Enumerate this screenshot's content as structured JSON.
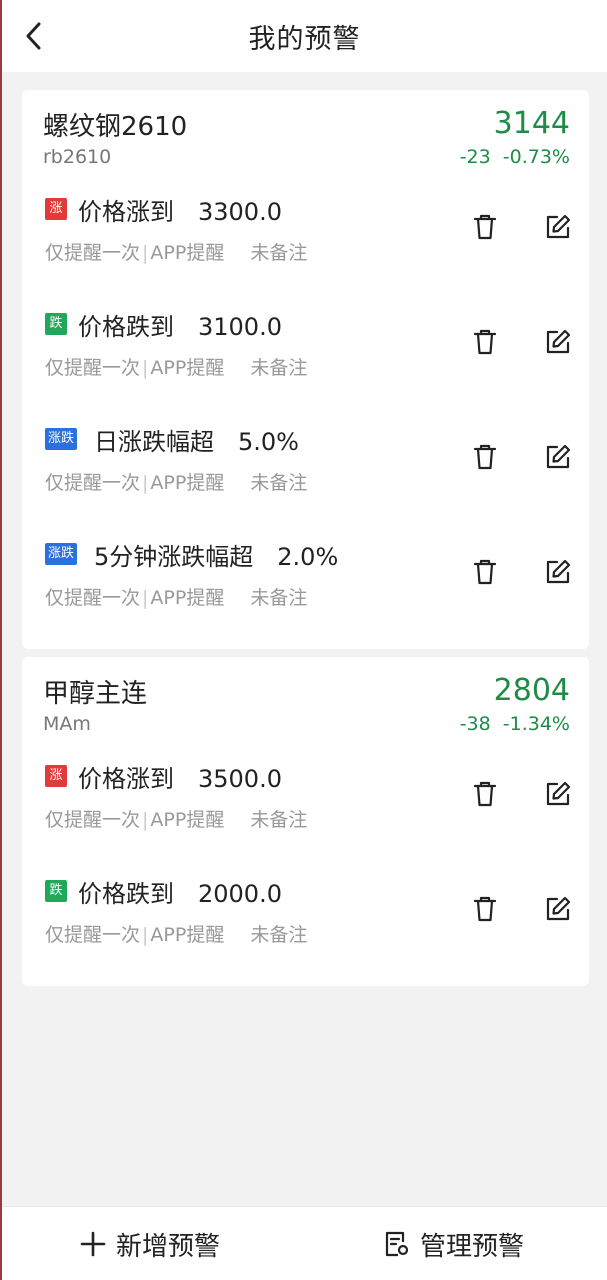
{
  "header": {
    "title": "我的预警",
    "back_icon": "chevron-left-icon"
  },
  "cards": [
    {
      "name": "螺纹钢2610",
      "code": "rb2610",
      "price": "3144",
      "change": "-23  -0.73%",
      "alerts": [
        {
          "badge": "涨",
          "badge_color": "red",
          "condition": "价格涨到",
          "value": "3300.0",
          "frequency": "仅提醒一次",
          "channel": "APP提醒",
          "note": "未备注"
        },
        {
          "badge": "跌",
          "badge_color": "green",
          "condition": "价格跌到",
          "value": "3100.0",
          "frequency": "仅提醒一次",
          "channel": "APP提醒",
          "note": "未备注"
        },
        {
          "badge": "涨跌",
          "badge_color": "blue",
          "condition": "日涨跌幅超",
          "value": "5.0%",
          "frequency": "仅提醒一次",
          "channel": "APP提醒",
          "note": "未备注"
        },
        {
          "badge": "涨跌",
          "badge_color": "blue",
          "condition": "5分钟涨跌幅超",
          "value": "2.0%",
          "frequency": "仅提醒一次",
          "channel": "APP提醒",
          "note": "未备注"
        }
      ]
    },
    {
      "name": "甲醇主连",
      "code": "MAm",
      "price": "2804",
      "change": "-38  -1.34%",
      "alerts": [
        {
          "badge": "涨",
          "badge_color": "red",
          "condition": "价格涨到",
          "value": "3500.0",
          "frequency": "仅提醒一次",
          "channel": "APP提醒",
          "note": "未备注"
        },
        {
          "badge": "跌",
          "badge_color": "green",
          "condition": "价格跌到",
          "value": "2000.0",
          "frequency": "仅提醒一次",
          "channel": "APP提醒",
          "note": "未备注"
        }
      ]
    }
  ],
  "bottom_bar": {
    "add_label": "新增预警",
    "manage_label": "管理预警"
  },
  "colors": {
    "down_green": "#1e8c47",
    "badge_red": "#e03a3a",
    "badge_green": "#1fa85a",
    "badge_blue": "#2c6fde"
  }
}
